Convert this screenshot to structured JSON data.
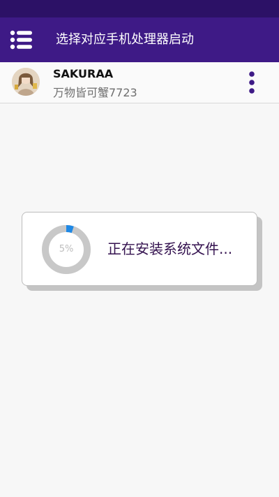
{
  "header": {
    "title": "选择对应手机处理器启动",
    "menu_icon": "hamburger-menu-icon",
    "background": "#3e1a86",
    "status_bar_color": "#2c1166"
  },
  "profile": {
    "name": "SAKURAA",
    "subtitle": "万物皆可蟹7723",
    "more_icon": "vertical-dots-icon",
    "more_icon_color": "#3e1a86"
  },
  "dialog": {
    "progress": 0.05,
    "progress_label": "5%",
    "progress_color": "#1e88e5",
    "ring_track_color": "#c8c8c8",
    "message": "正在安装系统文件..."
  }
}
